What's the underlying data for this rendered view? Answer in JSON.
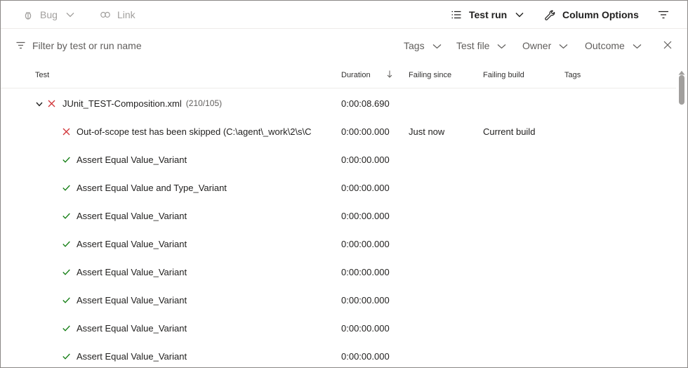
{
  "toolbar": {
    "bug_label": "Bug",
    "link_label": "Link",
    "test_run_label": "Test run",
    "column_options_label": "Column Options"
  },
  "filter": {
    "placeholder": "Filter by test or run name",
    "tags_label": "Tags",
    "test_file_label": "Test file",
    "owner_label": "Owner",
    "outcome_label": "Outcome"
  },
  "columns": {
    "test": "Test",
    "duration": "Duration",
    "failing_since": "Failing since",
    "failing_build": "Failing build",
    "tags": "Tags"
  },
  "group": {
    "name": "JUnit_TEST-Composition.xml",
    "count": "(210/105)",
    "duration": "0:00:08.690",
    "status": "failed"
  },
  "rows": [
    {
      "name": "Out-of-scope test has been skipped (C:\\agent\\_work\\2\\s\\C",
      "duration": "0:00:00.000",
      "failing_since": "Just now",
      "failing_build": "Current build",
      "status": "failed"
    },
    {
      "name": "Assert Equal Value_Variant",
      "duration": "0:00:00.000",
      "failing_since": "",
      "failing_build": "",
      "status": "passed"
    },
    {
      "name": "Assert Equal Value and Type_Variant",
      "duration": "0:00:00.000",
      "failing_since": "",
      "failing_build": "",
      "status": "passed"
    },
    {
      "name": "Assert Equal Value_Variant",
      "duration": "0:00:00.000",
      "failing_since": "",
      "failing_build": "",
      "status": "passed"
    },
    {
      "name": "Assert Equal Value_Variant",
      "duration": "0:00:00.000",
      "failing_since": "",
      "failing_build": "",
      "status": "passed"
    },
    {
      "name": "Assert Equal Value_Variant",
      "duration": "0:00:00.000",
      "failing_since": "",
      "failing_build": "",
      "status": "passed"
    },
    {
      "name": "Assert Equal Value_Variant",
      "duration": "0:00:00.000",
      "failing_since": "",
      "failing_build": "",
      "status": "passed"
    },
    {
      "name": "Assert Equal Value_Variant",
      "duration": "0:00:00.000",
      "failing_since": "",
      "failing_build": "",
      "status": "passed"
    },
    {
      "name": "Assert Equal Value_Variant",
      "duration": "0:00:00.000",
      "failing_since": "",
      "failing_build": "",
      "status": "passed"
    }
  ],
  "colors": {
    "failed": "#d13438",
    "passed": "#107c10",
    "disabled": "#a19f9d",
    "border": "#edebe9"
  },
  "icons": {
    "bug": "bug-icon",
    "link": "link-icon",
    "test_run": "list-icon",
    "column_options": "wrench-icon",
    "filter": "filter-icon",
    "chevron": "chevron-down-icon",
    "close": "close-icon",
    "sort": "arrow-down-icon",
    "failed": "cross-icon",
    "passed": "checkmark-icon"
  }
}
